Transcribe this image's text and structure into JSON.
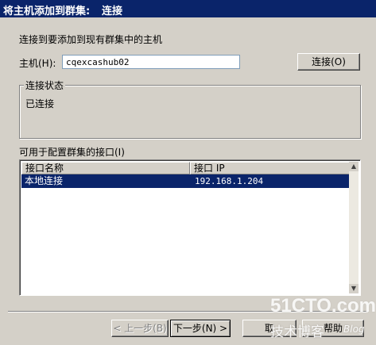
{
  "header": {
    "title": "将主机添加到群集:",
    "step": "连接"
  },
  "intro": "连接到要添加到现有群集中的主机",
  "host": {
    "label": "主机(H):",
    "value": "cqexcashub02",
    "connect_button": "连接(O)"
  },
  "status_group": {
    "legend": "连接状态",
    "text": "已连接"
  },
  "interfaces": {
    "label": "可用于配置群集的接口(I)",
    "columns": [
      "接口名称",
      "接口 IP"
    ],
    "rows": [
      {
        "name": "本地连接",
        "ip": "192.168.1.204"
      }
    ]
  },
  "footer": {
    "back": "< 上一步(B)",
    "next": "下一步(N) >",
    "cancel": "取",
    "help": "帮助"
  },
  "watermark": {
    "site": "51CTO.com",
    "sub": "技术博客",
    "blog": "Blog"
  }
}
